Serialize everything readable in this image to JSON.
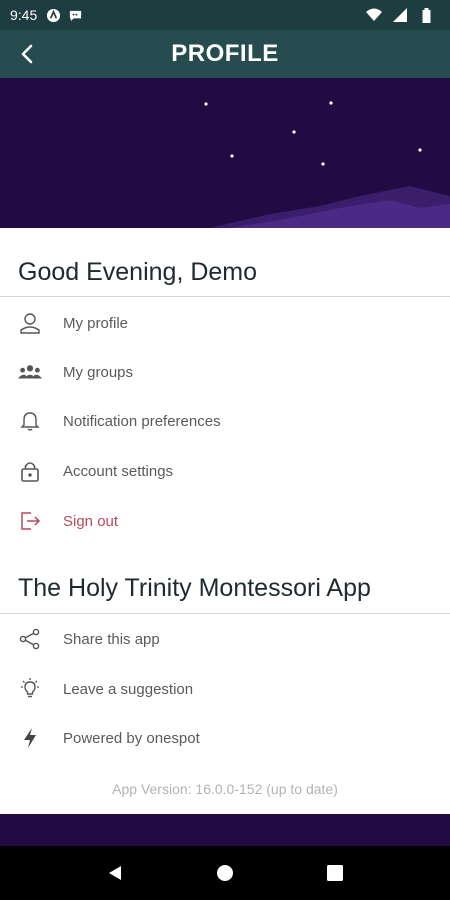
{
  "status_bar": {
    "time": "9:45"
  },
  "app_bar": {
    "title": "PROFILE"
  },
  "greeting": {
    "title": "Good Evening, Demo"
  },
  "account_menu": [
    {
      "label": "My profile",
      "icon": "person-icon"
    },
    {
      "label": "My groups",
      "icon": "group-icon"
    },
    {
      "label": "Notification preferences",
      "icon": "bell-icon"
    },
    {
      "label": "Account settings",
      "icon": "lock-icon"
    },
    {
      "label": "Sign out",
      "icon": "sign-out-icon"
    }
  ],
  "app_section": {
    "title": "The Holy Trinity Montessori App"
  },
  "app_menu": [
    {
      "label": "Share this app",
      "icon": "share-icon"
    },
    {
      "label": "Leave a suggestion",
      "icon": "lightbulb-icon"
    },
    {
      "label": "Powered by onespot",
      "icon": "lightning-icon"
    }
  ],
  "version": {
    "text": "App Version: 16.0.0-152 (up to date)"
  },
  "colors": {
    "header": "#264c4f",
    "status_bar": "#1d3d40",
    "night_sky": "#220a42",
    "sign_out": "#b84a5a"
  }
}
